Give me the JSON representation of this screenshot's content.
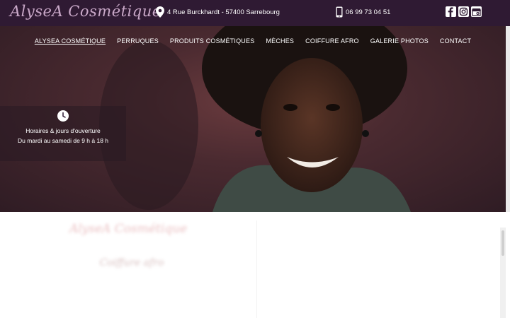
{
  "header": {
    "logo_text": "AlyseA Cosmétique",
    "address": "4 Rue Burckhardt - 57400 Sarrebourg",
    "phone": "06 99 73 04 51",
    "socials": [
      "facebook-icon",
      "instagram-icon",
      "google-business-icon"
    ]
  },
  "nav": {
    "items": [
      {
        "label": "ALYSEA COSMÉTIQUE",
        "active": true
      },
      {
        "label": "PERRUQUES"
      },
      {
        "label": "PRODUITS COSMÉTIQUES"
      },
      {
        "label": "MÈCHES"
      },
      {
        "label": "COIFFURE AFRO"
      },
      {
        "label": "GALERIE PHOTOS"
      },
      {
        "label": "CONTACT"
      }
    ]
  },
  "hours": {
    "title": "Horaires & jours d'ouverture",
    "schedule": "Du mardi au samedi de 9 h à 18 h"
  },
  "content": {
    "title": "AlyseA Cosmétique",
    "subtitle": "Coiffure afro",
    "paragraph": "",
    "line": ""
  },
  "colors": {
    "topbar": "#2f1a33",
    "logo": "#c9a8c8",
    "hero": "#4a2a30",
    "accent": "#d98b8f"
  }
}
